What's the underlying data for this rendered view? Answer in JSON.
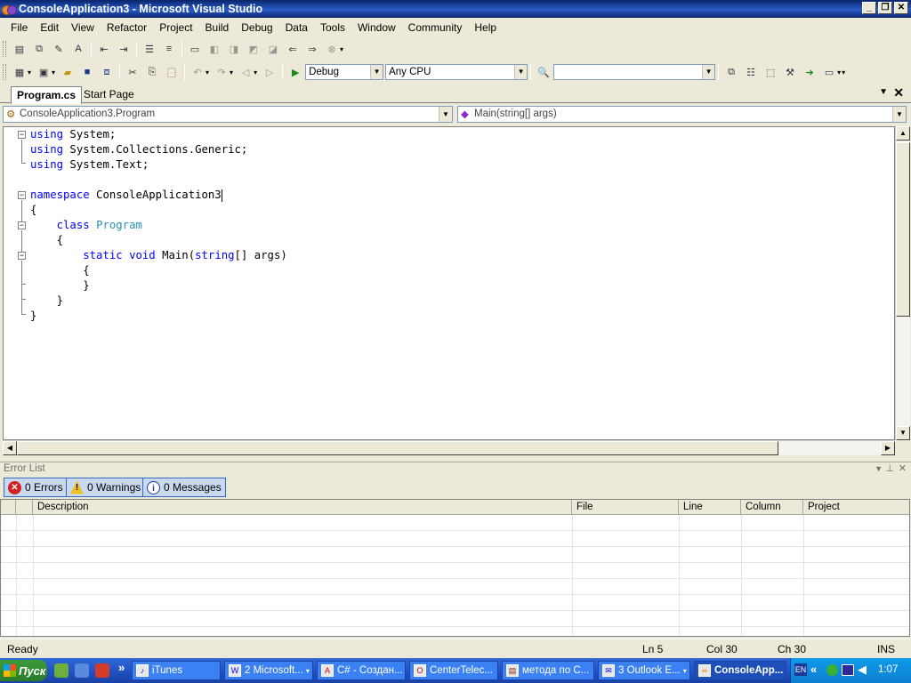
{
  "window": {
    "title": "ConsoleApplication3 - Microsoft Visual Studio"
  },
  "menu": [
    "File",
    "Edit",
    "View",
    "Refactor",
    "Project",
    "Build",
    "Debug",
    "Data",
    "Tools",
    "Window",
    "Community",
    "Help"
  ],
  "toolbar": {
    "config": "Debug",
    "platform": "Any CPU",
    "find_value": ""
  },
  "tabs": [
    {
      "label": "Program.cs",
      "active": true
    },
    {
      "label": "Start Page",
      "active": false
    }
  ],
  "nav": {
    "type_combo": "ConsoleApplication3.Program",
    "member_combo": "Main(string[] args)"
  },
  "code": {
    "lines": [
      [
        {
          "t": "using",
          "c": "kw"
        },
        {
          "t": " System;"
        }
      ],
      [
        {
          "t": "using",
          "c": "kw"
        },
        {
          "t": " System.Collections.Generic;"
        }
      ],
      [
        {
          "t": "using",
          "c": "kw"
        },
        {
          "t": " System.Text;"
        }
      ],
      [],
      [
        {
          "t": "namespace",
          "c": "kw"
        },
        {
          "t": " ConsoleApplication3"
        }
      ],
      [
        {
          "t": "{"
        }
      ],
      [
        {
          "t": "    "
        },
        {
          "t": "class",
          "c": "kw"
        },
        {
          "t": " "
        },
        {
          "t": "Program",
          "c": "ty"
        }
      ],
      [
        {
          "t": "    {"
        }
      ],
      [
        {
          "t": "        "
        },
        {
          "t": "static",
          "c": "kw"
        },
        {
          "t": " "
        },
        {
          "t": "void",
          "c": "kw"
        },
        {
          "t": " Main("
        },
        {
          "t": "string",
          "c": "kw"
        },
        {
          "t": "[] args)"
        }
      ],
      [
        {
          "t": "        {"
        }
      ],
      [
        {
          "t": "        }"
        }
      ],
      [
        {
          "t": "    }"
        }
      ],
      [
        {
          "t": "}"
        }
      ]
    ]
  },
  "error_list": {
    "title": "Error List",
    "errors_btn": "0 Errors",
    "warnings_btn": "0 Warnings",
    "messages_btn": "0 Messages",
    "columns": [
      "",
      "",
      "Description",
      "File",
      "Line",
      "Column",
      "Project"
    ]
  },
  "status": {
    "text": "Ready",
    "ln": "Ln 5",
    "col": "Col 30",
    "ch": "Ch 30",
    "mode": "INS"
  },
  "taskbar": {
    "start": "Пуск",
    "buttons": [
      "iTunes",
      "2 Microsoft...",
      "C# - Создан...",
      "CenterTelec...",
      "метода по С...",
      "3 Outlook E...",
      "ConsoleApp..."
    ],
    "lang": "EN",
    "clock": "1:07"
  }
}
